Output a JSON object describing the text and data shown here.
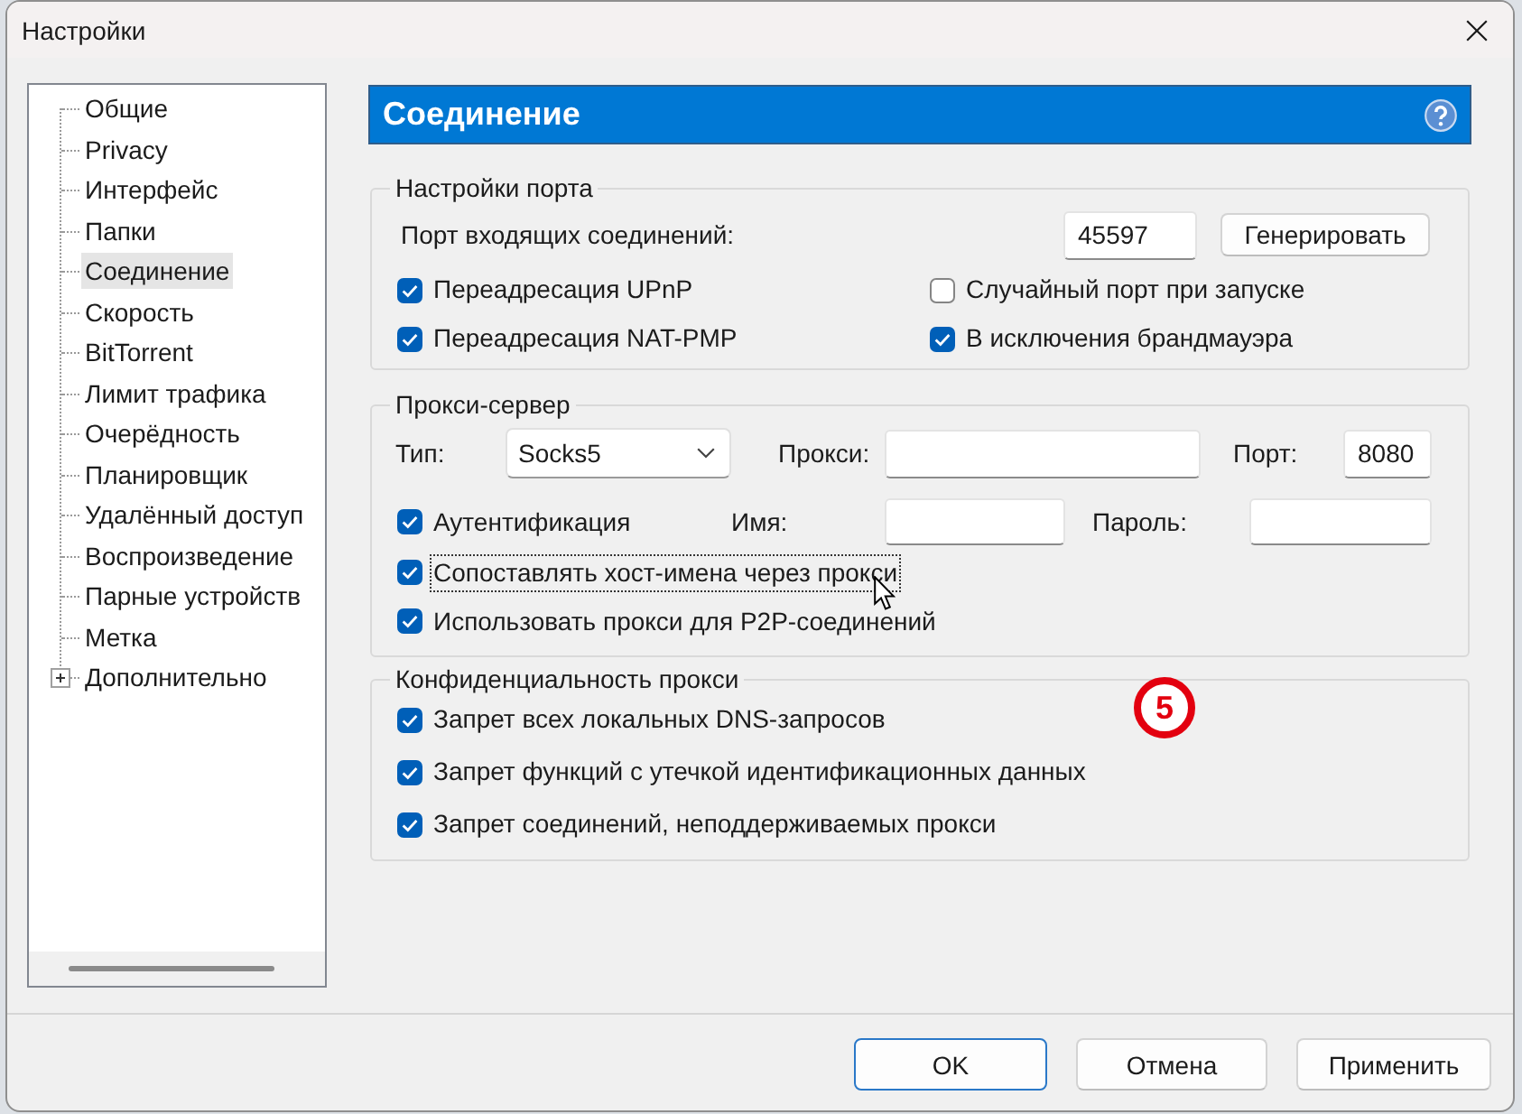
{
  "window": {
    "title": "Настройки"
  },
  "sidebar": {
    "items": [
      {
        "label": "Общие",
        "kind": "leaf",
        "selected": false
      },
      {
        "label": "Privacy",
        "kind": "leaf",
        "selected": false
      },
      {
        "label": "Интерфейс",
        "kind": "leaf",
        "selected": false
      },
      {
        "label": "Папки",
        "kind": "leaf",
        "selected": false
      },
      {
        "label": "Соединение",
        "kind": "leaf",
        "selected": true
      },
      {
        "label": "Скорость",
        "kind": "leaf",
        "selected": false
      },
      {
        "label": "BitTorrent",
        "kind": "leaf",
        "selected": false
      },
      {
        "label": "Лимит трафика",
        "kind": "leaf",
        "selected": false
      },
      {
        "label": "Очерёдность",
        "kind": "leaf",
        "selected": false
      },
      {
        "label": "Планировщик",
        "kind": "leaf",
        "selected": false
      },
      {
        "label": "Удалённый доступ",
        "kind": "leaf",
        "selected": false
      },
      {
        "label": "Воспроизведение",
        "kind": "leaf",
        "selected": false
      },
      {
        "label": "Парные устройств",
        "kind": "leaf",
        "selected": false
      },
      {
        "label": "Метка",
        "kind": "leaf",
        "selected": false
      },
      {
        "label": "Дополнительно",
        "kind": "group",
        "expanded": false,
        "selected": false
      }
    ]
  },
  "section": {
    "title": "Соединение"
  },
  "port_settings": {
    "legend": "Настройки порта",
    "port_label": "Порт входящих соединений:",
    "port_value": "45597",
    "generate_button": "Генерировать",
    "options": [
      {
        "label": "Переадресация UPnP",
        "checked": true
      },
      {
        "label": "Случайный порт при запуске",
        "checked": false
      },
      {
        "label": "Переадресация NAT-PMP",
        "checked": true
      },
      {
        "label": "В исключения брандмауэра",
        "checked": true
      }
    ]
  },
  "proxy_server": {
    "legend": "Прокси-сервер",
    "type_label": "Тип:",
    "type_value": "Socks5",
    "address_label": "Прокси:",
    "port_label": "Порт:",
    "port_value": "8080",
    "authentication": {
      "label": "Аутентификация",
      "checked": true
    },
    "username_label": "Имя:",
    "password_label": "Пароль:",
    "options": [
      {
        "label": "Сопоставлять хост-имена через прокси",
        "checked": true,
        "focused": true
      },
      {
        "label": "Использовать прокси для P2P-соединений",
        "checked": true,
        "focused": false
      }
    ]
  },
  "proxy_privacy": {
    "legend": "Конфиденциальность прокси",
    "options": [
      {
        "label": "Запрет всех локальных DNS-запросов",
        "checked": true
      },
      {
        "label": "Запрет функций с утечкой идентификационных данных",
        "checked": true
      },
      {
        "label": "Запрет соединений, неподдерживаемых прокси",
        "checked": true
      }
    ]
  },
  "annotation": {
    "label": "5"
  },
  "buttons": [
    {
      "label": "OK",
      "default": true
    },
    {
      "label": "Отмена",
      "default": false
    },
    {
      "label": "Применить",
      "default": false
    }
  ]
}
